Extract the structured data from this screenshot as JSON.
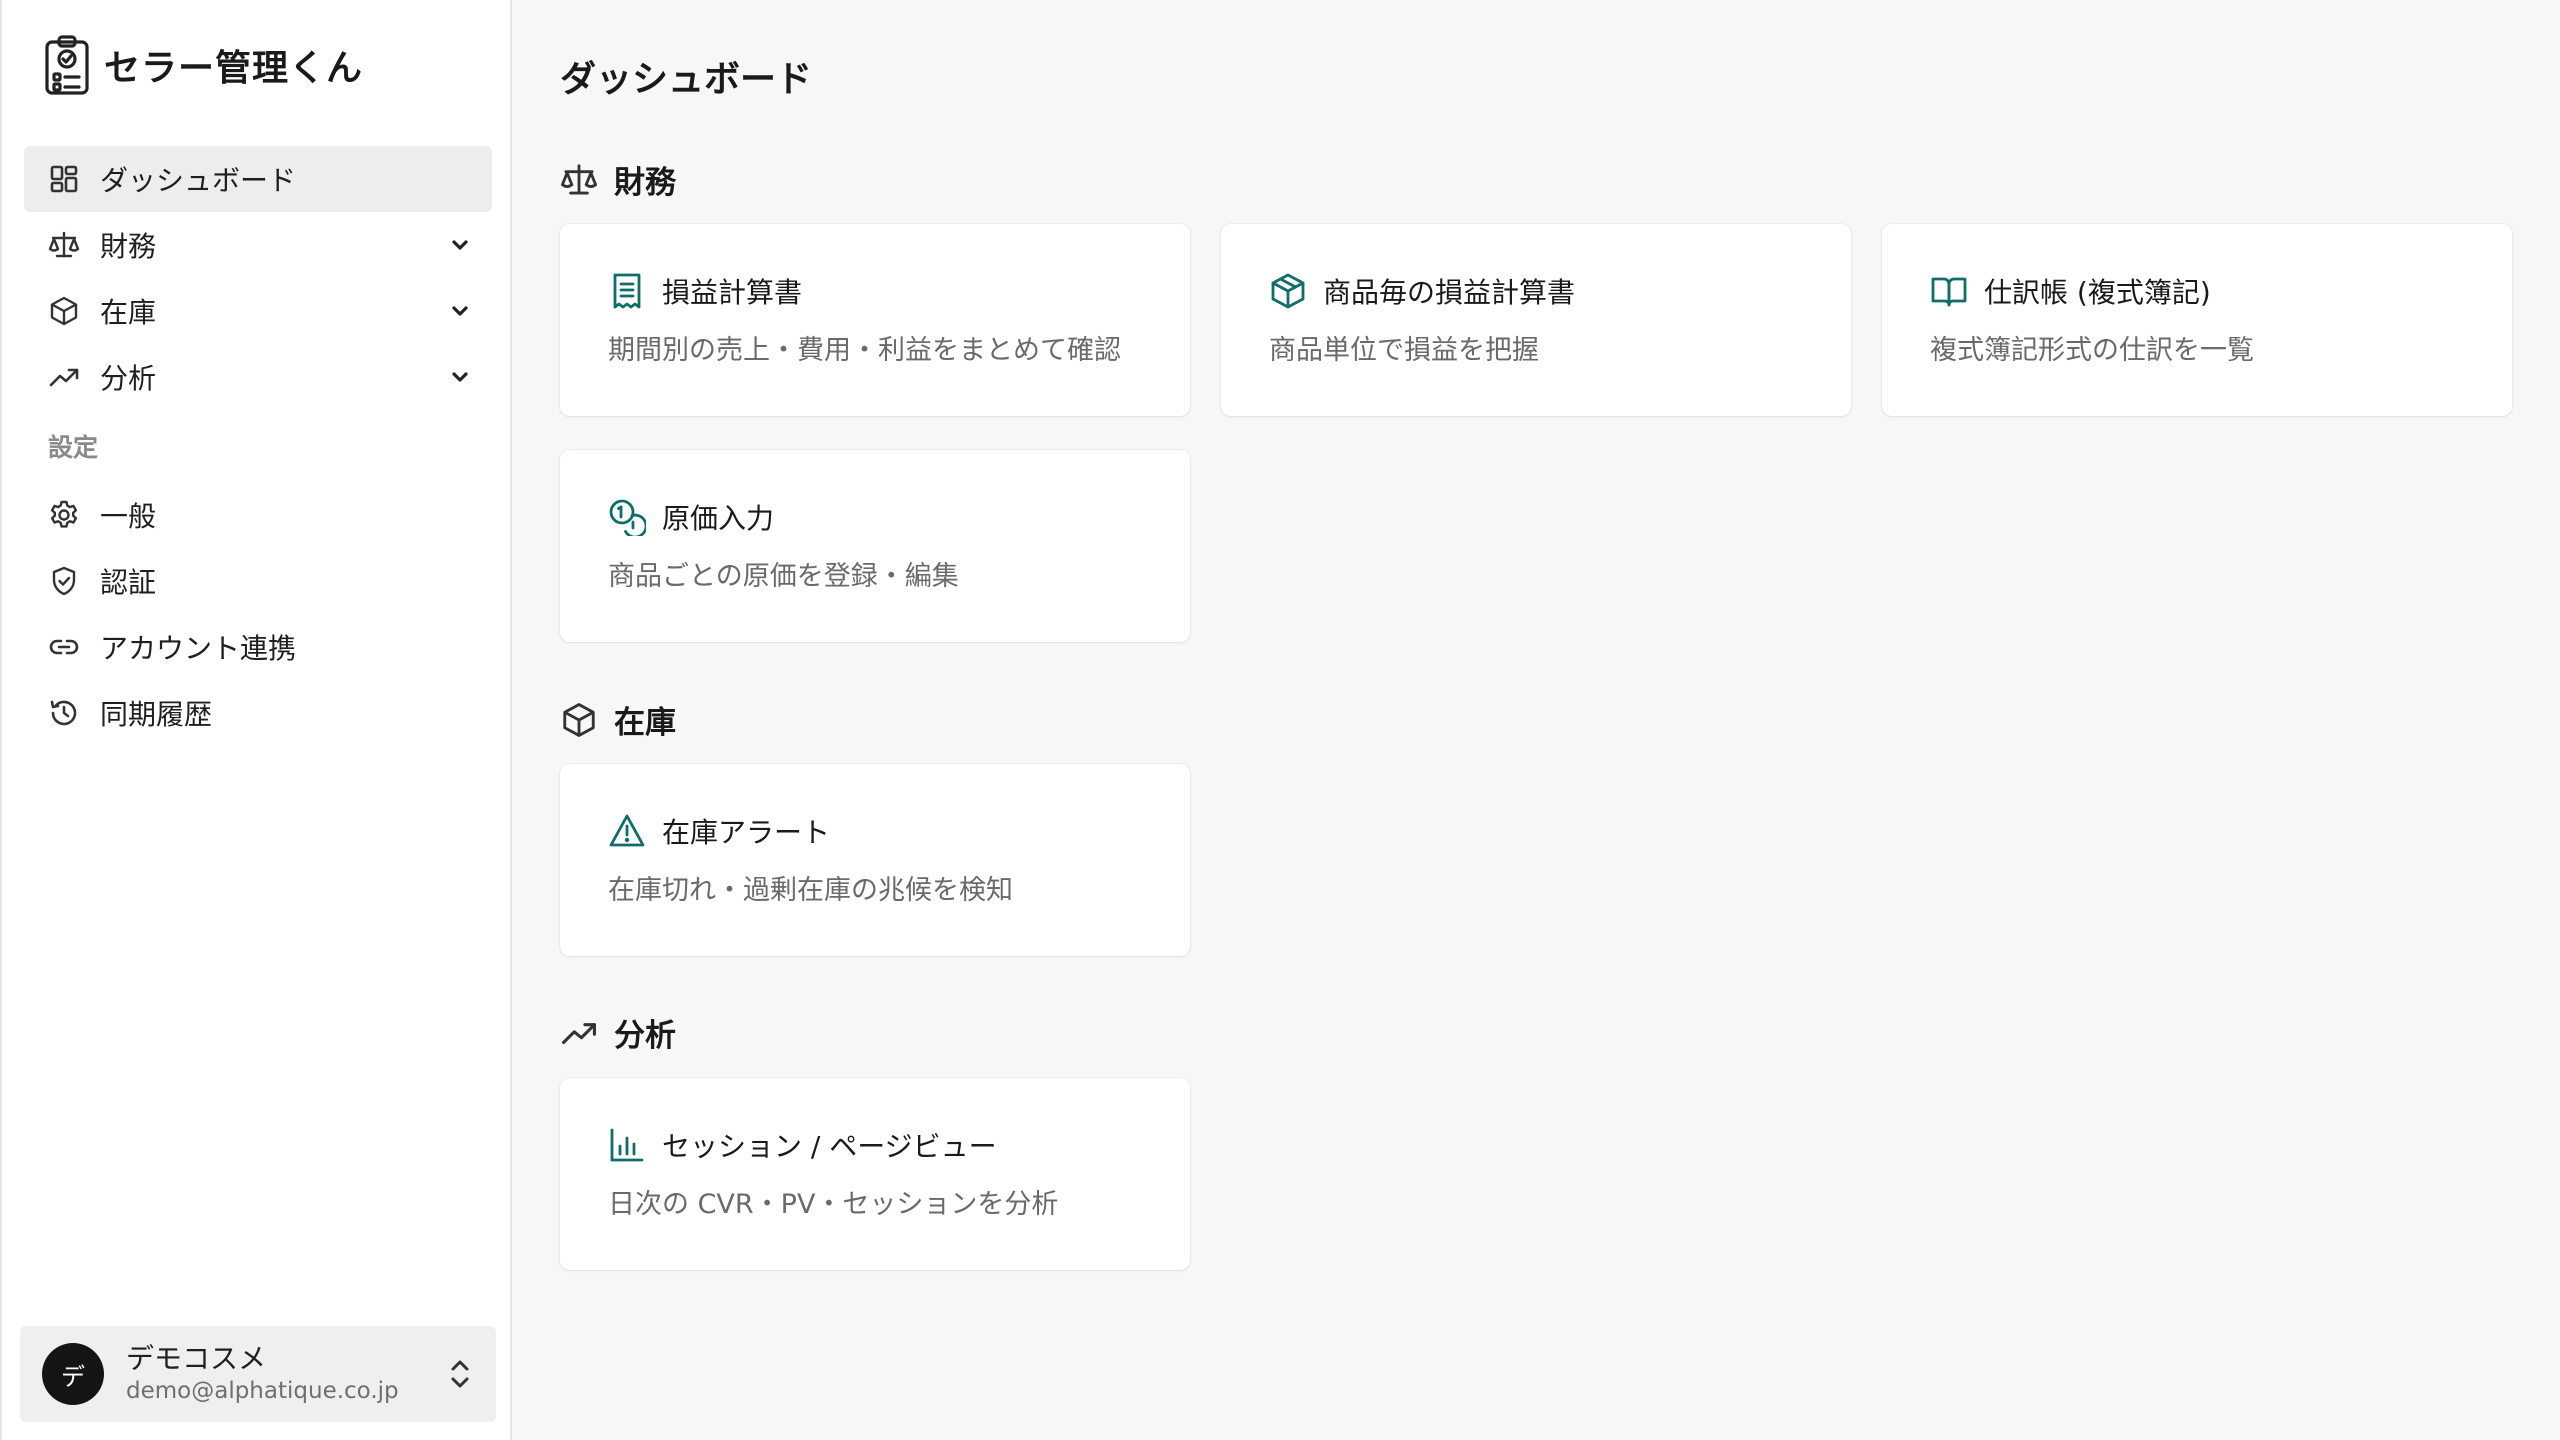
{
  "app": {
    "name": "セラー管理くん"
  },
  "sidebar": {
    "items": [
      {
        "label": "ダッシュボード"
      },
      {
        "label": "財務"
      },
      {
        "label": "在庫"
      },
      {
        "label": "分析"
      }
    ],
    "settings_heading": "設定",
    "settings_items": [
      {
        "label": "一般"
      },
      {
        "label": "認証"
      },
      {
        "label": "アカウント連携"
      },
      {
        "label": "同期履歴"
      }
    ]
  },
  "user": {
    "avatar_initial": "デ",
    "name": "デモコスメ",
    "email": "demo@alphatique.co.jp"
  },
  "main": {
    "title": "ダッシュボード",
    "sections": [
      {
        "label": "財務",
        "cards": [
          {
            "title": "損益計算書",
            "desc": "期間別の売上・費用・利益をまとめて確認"
          },
          {
            "title": "商品毎の損益計算書",
            "desc": "商品単位で損益を把握"
          },
          {
            "title": "仕訳帳 (複式簿記)",
            "desc": "複式簿記形式の仕訳を一覧"
          },
          {
            "title": "原価入力",
            "desc": "商品ごとの原価を登録・編集"
          }
        ]
      },
      {
        "label": "在庫",
        "cards": [
          {
            "title": "在庫アラート",
            "desc": "在庫切れ・過剰在庫の兆候を検知"
          }
        ]
      },
      {
        "label": "分析",
        "cards": [
          {
            "title": "セッション / ページビュー",
            "desc": "日次の CVR・PV・セッションを分析"
          }
        ]
      }
    ]
  },
  "colors": {
    "accent": "#0f6e6a",
    "active_bg": "#ededed",
    "page_bg": "#f7f7f7"
  },
  "icons": {
    "brand": "clipboard-check-icon",
    "dashboard": "grid-icon",
    "finance": "scale-icon",
    "inventory": "box-icon",
    "analytics": "trending-up-icon",
    "general": "gear-icon",
    "auth": "shield-check-icon",
    "link": "link-icon",
    "history": "history-icon"
  }
}
